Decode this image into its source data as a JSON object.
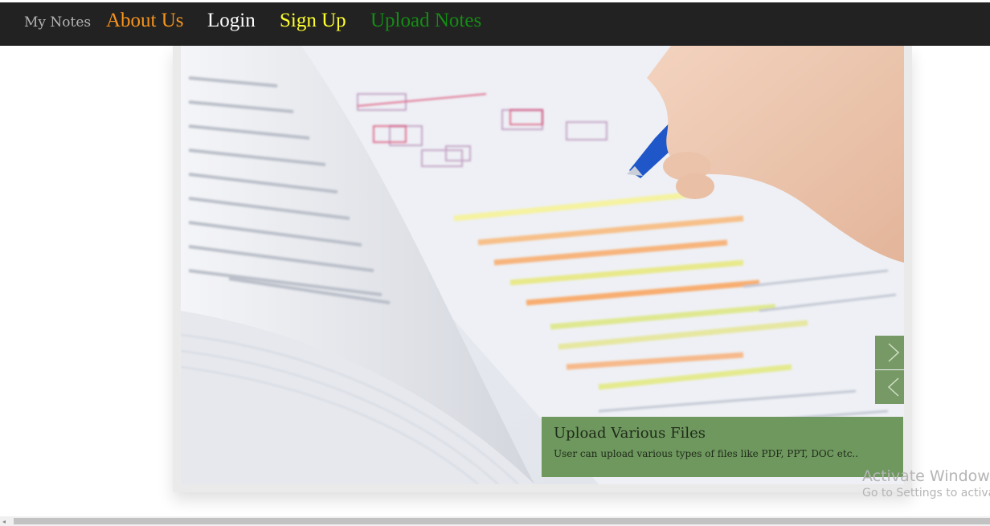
{
  "nav": {
    "brand": "My Notes",
    "links": [
      {
        "label": "About Us",
        "color": "#f7941d"
      },
      {
        "label": "Login",
        "color": "#ffffff"
      },
      {
        "label": "Sign Up",
        "color": "#ffff2e"
      },
      {
        "label": "Upload Notes",
        "color": "#148c14"
      }
    ]
  },
  "slider": {
    "caption_title": "Upload Various Files",
    "caption_text": "User can upload various types of files like PDF, PPT, DOC etc..",
    "next_icon": "chevron-right-icon",
    "prev_icon": "chevron-left-icon",
    "caption_color": "#6f985f"
  },
  "watermark": {
    "title": "Activate Windows",
    "subtitle": "Go to Settings to activat"
  }
}
